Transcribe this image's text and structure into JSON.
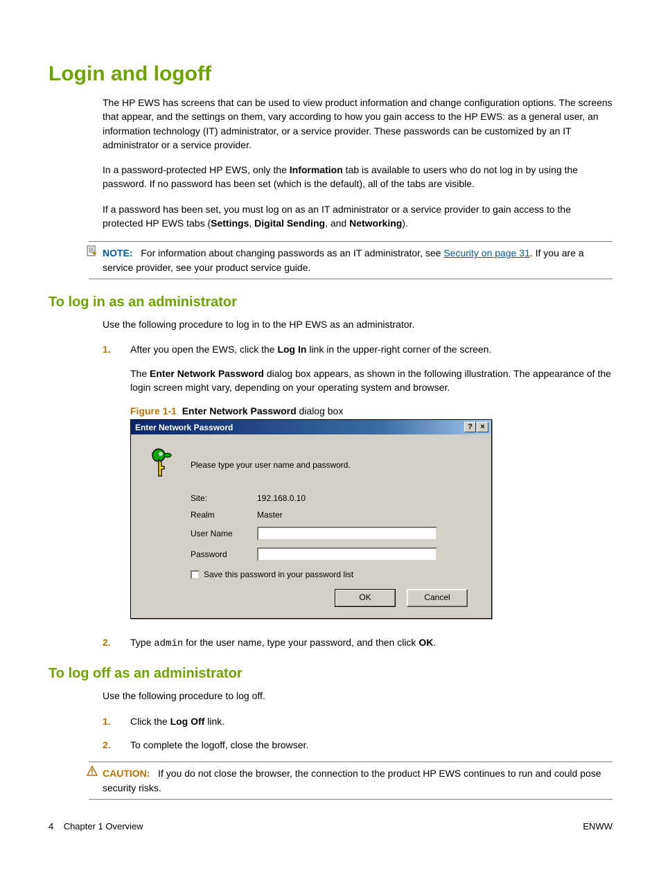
{
  "title": "Login and logoff",
  "intro": {
    "p1": "The HP EWS has screens that can be used to view product information and change configuration options. The screens that appear, and the settings on them, vary according to how you gain access to the HP EWS: as a general user, an information technology (IT) administrator, or a service provider. These passwords can be customized by an IT administrator or a service provider.",
    "p2a": "In a password-protected HP EWS, only the ",
    "p2b_bold": "Information",
    "p2c": " tab is available to users who do not log in by using the password. If no password has been set (which is the default), all of the tabs are visible.",
    "p3a": "If a password has been set, you must log on as an IT administrator or a service provider to gain access to the protected HP EWS tabs (",
    "p3_settings": "Settings",
    "p3_sep1": ", ",
    "p3_digital": "Digital Sending",
    "p3_sep2": ", and ",
    "p3_networking": "Networking",
    "p3_end": ")."
  },
  "note": {
    "label": "NOTE:",
    "text_a": "For information about changing passwords as an IT administrator, see ",
    "link_text": "Security on page 31",
    "text_b": ". If you are a service provider, see your product service guide."
  },
  "login_h2": "To log in as an administrator",
  "login_intro": "Use the following procedure to log in to the HP EWS as an administrator.",
  "login_steps": {
    "s1_num": "1.",
    "s1a": "After you open the EWS, click the ",
    "s1b_bold": "Log In",
    "s1c": " link in the upper-right corner of the screen.",
    "s1_sub_a": "The ",
    "s1_sub_bold": "Enter Network Password",
    "s1_sub_b": " dialog box appears, as shown in the following illustration. The appearance of the login screen might vary, depending on your operating system and browser.",
    "s2_num": "2.",
    "s2a": "Type ",
    "s2_code": "admin",
    "s2b": " for the user name, type your password, and then click ",
    "s2c_bold": "OK",
    "s2d": "."
  },
  "figure": {
    "id": "Figure 1-1",
    "caption_bold": "Enter Network Password",
    "caption_tail": " dialog box"
  },
  "dialog": {
    "title": "Enter Network Password",
    "help_btn": "?",
    "close_btn": "×",
    "prompt": "Please type your user name and password.",
    "site_label": "Site:",
    "site_value": "192.168.0.10",
    "realm_label": "Realm",
    "realm_value": "Master",
    "user_label": "User Name",
    "pass_label": "Password",
    "save_pw": "Save this password in your password list",
    "ok": "OK",
    "cancel": "Cancel"
  },
  "logoff_h2": "To log off as an administrator",
  "logoff_intro": "Use the following procedure to log off.",
  "logoff_steps": {
    "s1_num": "1.",
    "s1a": "Click the ",
    "s1b_bold": "Log Off",
    "s1c": " link.",
    "s2_num": "2.",
    "s2": "To complete the logoff, close the browser."
  },
  "caution": {
    "label": "CAUTION:",
    "text": "If you do not close the browser, the connection to the product HP EWS continues to run and could pose security risks."
  },
  "footer": {
    "page": "4",
    "chapter": "Chapter 1   Overview",
    "lang": "ENWW"
  }
}
